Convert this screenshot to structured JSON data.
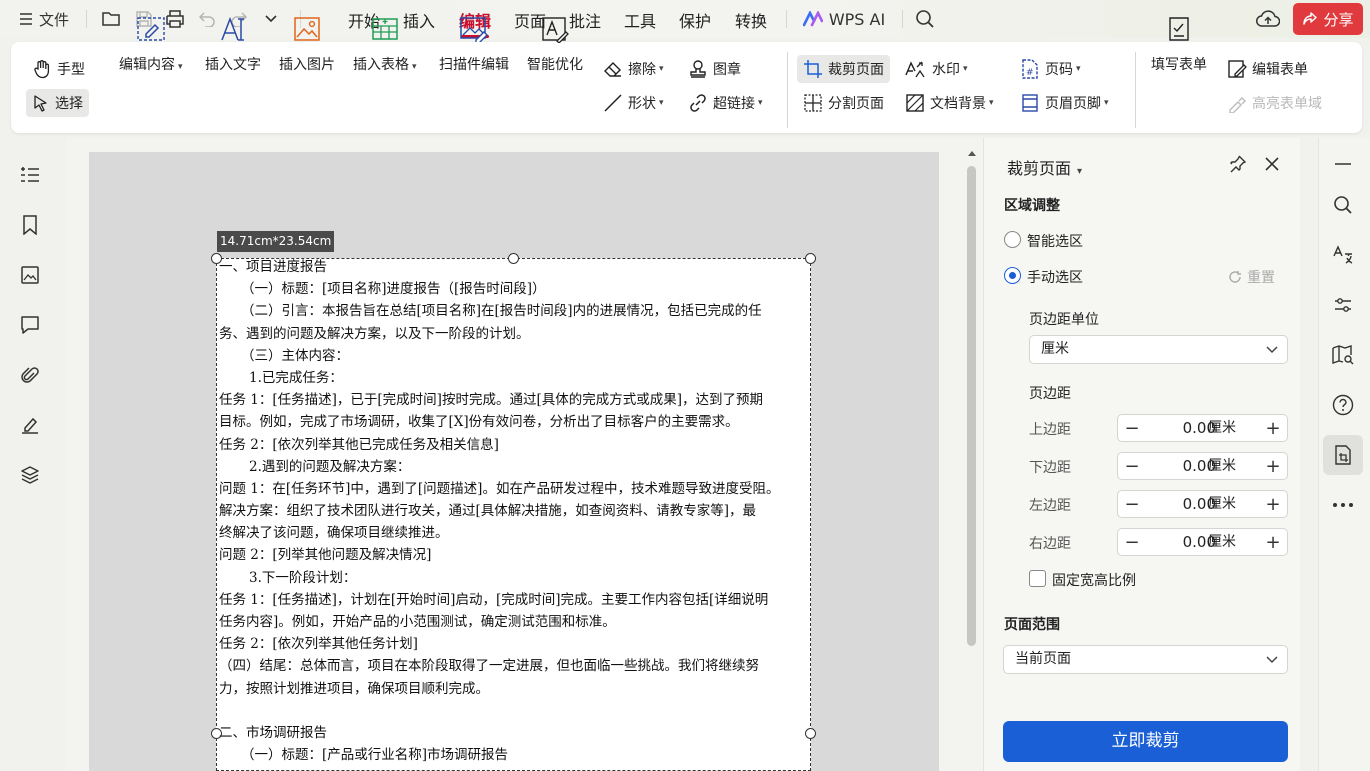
{
  "titlebar": {
    "file_menu": "文件",
    "tabs": [
      "开始",
      "插入",
      "编辑",
      "页面",
      "批注",
      "工具",
      "保护",
      "转换"
    ],
    "active_tab": "编辑",
    "wps_ai": "WPS AI",
    "share": "分享"
  },
  "ribbon": {
    "hand": "手型",
    "select": "选择",
    "edit_content": "编辑内容",
    "insert_text": "插入文字",
    "insert_image": "插入图片",
    "insert_table": "插入表格",
    "scan_edit": "扫描件编辑",
    "smart_optimize": "智能优化",
    "erase": "擦除",
    "shape": "形状",
    "stamp": "图章",
    "hyperlink": "超链接",
    "crop_page": "裁剪页面",
    "split_page": "分割页面",
    "watermark": "水印",
    "doc_background": "文档背景",
    "page_number": "页码",
    "header_footer": "页眉页脚",
    "fill_form": "填写表单",
    "edit_form": "编辑表单",
    "highlight_form": "高亮表单域"
  },
  "document": {
    "size_tag": "14.71cm*23.54cm",
    "lines": [
      "一、项目进度报告",
      "（一）标题：[项目名称]进度报告（[报告时间段]）",
      "（二）引言：本报告旨在总结[项目名称]在[报告时间段]内的进展情况，包括已完成的任",
      "务、遇到的问题及解决方案，以及下一阶段的计划。",
      "（三）主体内容：",
      "1.已完成任务：",
      "任务 1：[任务描述]，已于[完成时间]按时完成。通过[具体的完成方式或成果]，达到了预期",
      "目标。例如，完成了市场调研，收集了[X]份有效问卷，分析出了目标客户的主要需求。",
      "任务 2：[依次列举其他已完成任务及相关信息]",
      "2.遇到的问题及解决方案：",
      "问题 1：在[任务环节]中，遇到了[问题描述]。如在产品研发过程中，技术难题导致进度受阻。",
      "解决方案：组织了技术团队进行攻关，通过[具体解决措施，如查阅资料、请教专家等]，最",
      "终解决了该问题，确保项目继续推进。",
      "问题 2：[列举其他问题及解决情况]",
      "3.下一阶段计划：",
      "任务 1：[任务描述]，计划在[开始时间]启动，[完成时间]完成。主要工作内容包括[详细说明",
      "任务内容]。例如，开始产品的小范围测试，确定测试范围和标准。",
      "任务 2：[依次列举其他任务计划]",
      "（四）结尾：总体而言，项目在本阶段取得了一定进展，但也面临一些挑战。我们将继续努",
      "力，按照计划推进项目，确保项目顺利完成。",
      "",
      "二、市场调研报告",
      "（一）标题：[产品或行业名称]市场调研报告"
    ]
  },
  "panel": {
    "title": "裁剪页面",
    "region_adjust": "区域调整",
    "smart_select": "智能选区",
    "manual_select": "手动选区",
    "reset": "重置",
    "margin_unit_label": "页边距单位",
    "margin_unit_value": "厘米",
    "margin_label": "页边距",
    "margins": [
      {
        "label": "上边距",
        "value": "0.00",
        "unit": "厘米"
      },
      {
        "label": "下边距",
        "value": "0.00",
        "unit": "厘米"
      },
      {
        "label": "左边距",
        "value": "0.00",
        "unit": "厘米"
      },
      {
        "label": "右边距",
        "value": "0.00",
        "unit": "厘米"
      }
    ],
    "lock_ratio": "固定宽高比例",
    "page_range_label": "页面范围",
    "page_range_value": "当前页面",
    "crop_now": "立即裁剪",
    "selected_mode": "manual"
  },
  "colors": {
    "accent_red": "#c8102e",
    "primary_blue": "#1a5fd6",
    "share_red": "#e03a3e"
  }
}
